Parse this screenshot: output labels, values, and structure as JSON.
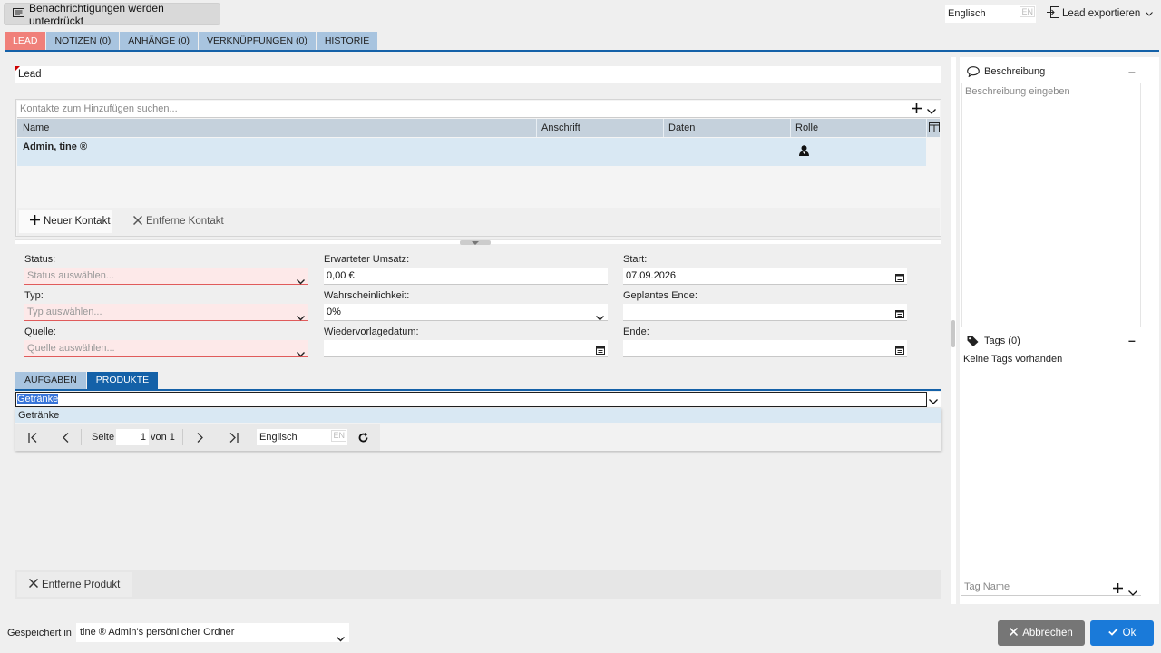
{
  "topbar": {
    "notification_btn": "Benachrichtigungen werden unterdrückt",
    "language_value": "Englisch",
    "language_badge": "EN",
    "export_btn": "Lead exportieren"
  },
  "tabs": [
    {
      "label": "LEAD"
    },
    {
      "label": "NOTIZEN (0)"
    },
    {
      "label": "ANHÄNGE (0)"
    },
    {
      "label": "VERKNÜPFUNGEN (0)"
    },
    {
      "label": "HISTORIE"
    }
  ],
  "lead_title": "Lead",
  "contacts": {
    "search_placeholder": "Kontakte zum Hinzufügen suchen...",
    "columns": [
      "Name",
      "Anschrift",
      "Daten",
      "Rolle"
    ],
    "rows": [
      {
        "name": "Admin, tine ®",
        "anschrift": "",
        "daten": ""
      }
    ],
    "new_btn": "Neuer Kontakt",
    "remove_btn": "Entferne Kontakt"
  },
  "form": {
    "status_label": "Status:",
    "status_placeholder": "Status auswählen...",
    "typ_label": "Typ:",
    "typ_placeholder": "Typ auswählen...",
    "quelle_label": "Quelle:",
    "quelle_placeholder": "Quelle auswählen...",
    "umsatz_label": "Erwarteter Umsatz:",
    "umsatz_value": "0,00 €",
    "wahrsch_label": "Wahrscheinlichkeit:",
    "wahrsch_value": "0%",
    "wiedervorlage_label": "Wiedervorlagedatum:",
    "wiedervorlage_value": "",
    "start_label": "Start:",
    "start_value": "07.09.2026",
    "geplant_label": "Geplantes Ende:",
    "geplant_value": "",
    "ende_label": "Ende:",
    "ende_value": ""
  },
  "subtabs": [
    {
      "label": "AUFGABEN"
    },
    {
      "label": "PRODUKTE"
    }
  ],
  "products": {
    "input_value": "Getränke",
    "dropdown_option": "Getränke",
    "pager_page_label": "Seite",
    "pager_page_value": "1",
    "pager_of": "von 1",
    "pager_lang": "Englisch",
    "pager_lang_badge": "EN",
    "remove_btn": "Entferne Produkt"
  },
  "right": {
    "description_title": "Beschreibung",
    "description_placeholder": "Beschreibung eingeben",
    "tags_title": "Tags (0)",
    "tags_empty": "Keine Tags vorhanden",
    "tag_name_placeholder": "Tag Name"
  },
  "footer": {
    "saved_in_label": "Gespeichert in",
    "saved_in_value": "tine ® Admin's persönlicher Ordner",
    "cancel_btn": "Abbrechen",
    "ok_btn": "Ok"
  },
  "colors": {
    "accent_blue": "#1461a8",
    "lead_tab": "#f0807a",
    "required_bg": "#fde9e9"
  }
}
